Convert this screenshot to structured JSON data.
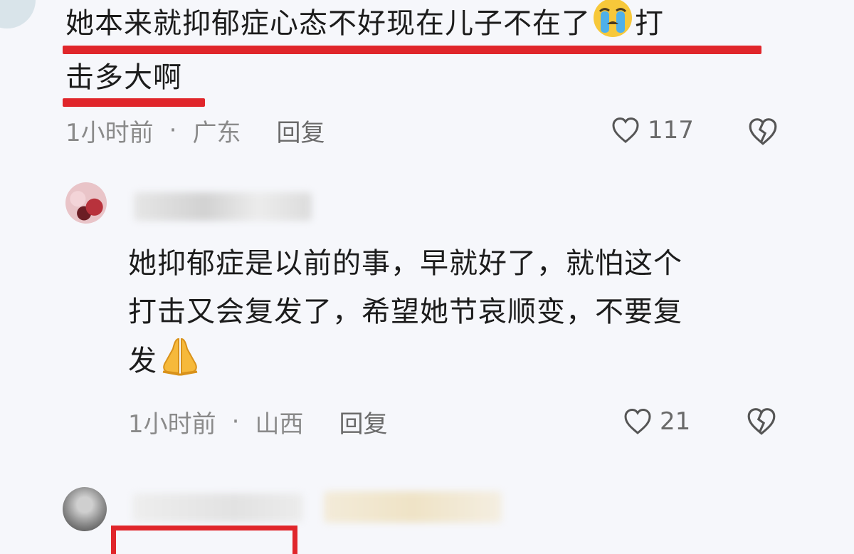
{
  "comments": [
    {
      "text_line1": "她本来就抑郁症心态不好现在儿子不在了",
      "text_line1_tail": "打",
      "text_line2": "击多大啊",
      "emoji": "crying-face",
      "time": "1小时前",
      "separator": "·",
      "location": "广东",
      "reply_label": "回复",
      "likes": "117"
    },
    {
      "text_line1": "她抑郁症是以前的事，早就好了，就怕这个",
      "text_line2": "打击又会复发了，希望她节哀顺变，不要复",
      "text_line3": "发",
      "emoji": "folded-hands",
      "time": "1小时前",
      "separator": "·",
      "location": "山西",
      "reply_label": "回复",
      "likes": "21"
    }
  ],
  "colors": {
    "highlight_red": "#e0262b",
    "meta_gray": "#8a8a8a",
    "background": "#f6f7fb"
  },
  "icons": [
    "heart-outline-icon",
    "broken-heart-icon",
    "crying-face-emoji",
    "folded-hands-emoji"
  ]
}
